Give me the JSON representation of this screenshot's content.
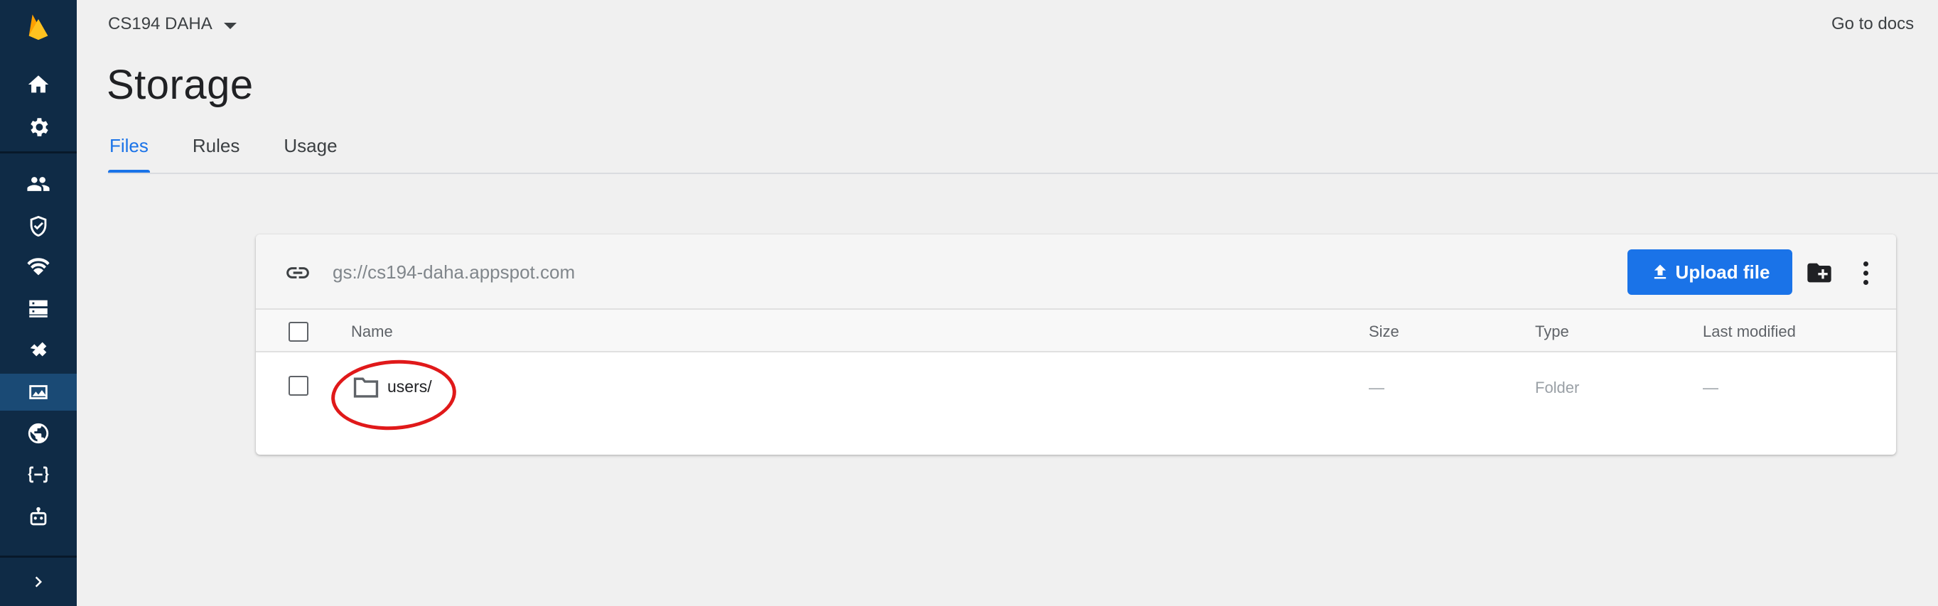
{
  "rail": {
    "items": [
      {
        "icon": "firebase-logo-icon"
      },
      {
        "icon": "home-icon"
      },
      {
        "icon": "settings-gear-icon"
      },
      {
        "icon": "authentication-icon"
      },
      {
        "icon": "security-shield-icon"
      },
      {
        "icon": "firestore-icon"
      },
      {
        "icon": "database-icon"
      },
      {
        "icon": "hosting-icon"
      },
      {
        "icon": "storage-icon",
        "active": true
      },
      {
        "icon": "globe-icon"
      },
      {
        "icon": "functions-icon"
      },
      {
        "icon": "ml-robot-icon"
      }
    ],
    "expand_icon": "chevron-right-icon"
  },
  "header": {
    "project_name": "CS194 DAHA",
    "docs_link": "Go to docs",
    "page_title": "Storage"
  },
  "tabs": [
    {
      "label": "Files",
      "active": true
    },
    {
      "label": "Rules",
      "active": false
    },
    {
      "label": "Usage",
      "active": false
    }
  ],
  "bucket": {
    "url": "gs://cs194-daha.appspot.com",
    "upload_label": "Upload file"
  },
  "table": {
    "columns": [
      "Name",
      "Size",
      "Type",
      "Last modified"
    ],
    "rows": [
      {
        "name": "users/",
        "size": "—",
        "type": "Folder",
        "modified": "—"
      }
    ]
  },
  "colors": {
    "rail": "#0f2b46",
    "accent": "#1a73e8",
    "annotation": "#e0191a"
  }
}
